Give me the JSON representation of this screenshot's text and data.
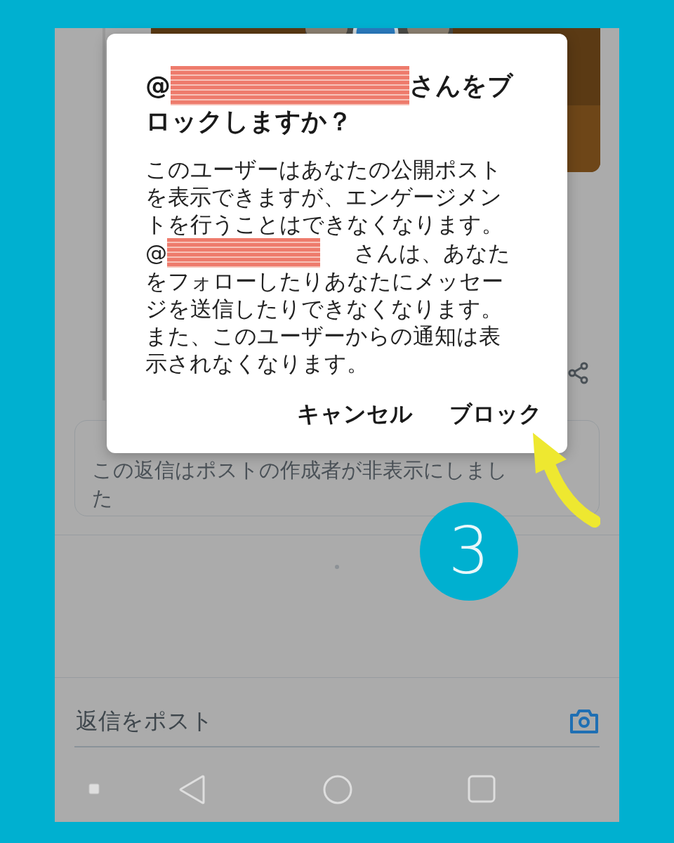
{
  "hidden_reply": {
    "text": "この返信はポストの作成者が非表示にしました"
  },
  "reply_bar": {
    "placeholder": "返信をポスト"
  },
  "dialog": {
    "title_prefix": "@",
    "title_line_1": "さんをブ",
    "title_line_2": "ロックしますか？",
    "body_1": "このユーザーはあなたの公開ポストを表示できますが、エンゲージメントを行うことはできなくなります。",
    "body_2_prefix": "@",
    "body_2_line_1": "さんは、あなた",
    "body_2": "をフォローしたりあなたにメッセージを送信したりできなくなります。また、このユーザーからの通知は表示されなくなります。",
    "buttons": [
      {
        "label": "キャンセル"
      },
      {
        "label": "ブロック"
      }
    ]
  },
  "annotation": {
    "step": "3"
  }
}
